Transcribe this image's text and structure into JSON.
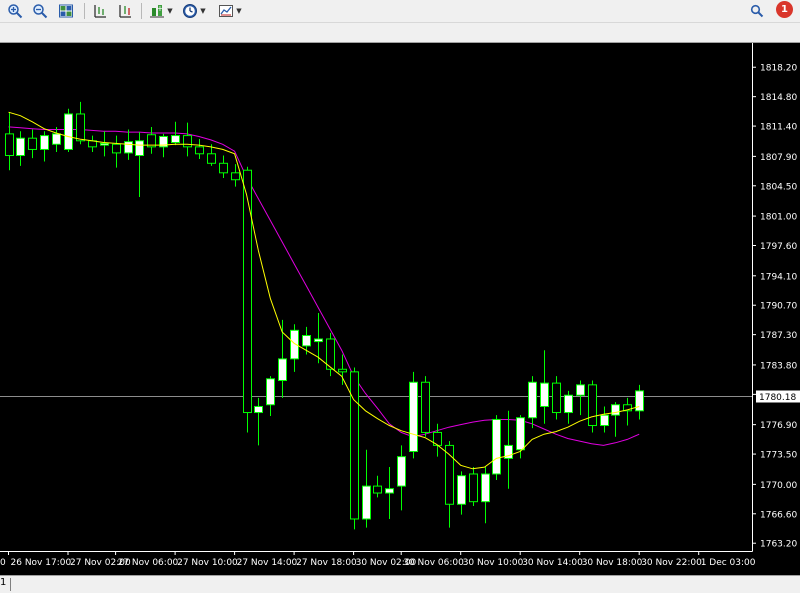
{
  "toolbar": {
    "items": [
      {
        "name": "zoom-in",
        "icon": "zoom-in-icon"
      },
      {
        "name": "zoom-out",
        "icon": "zoom-out-icon"
      },
      {
        "name": "tile-windows",
        "icon": "grid-icon"
      },
      {
        "name": "period-separators",
        "icon": "period-separator-icon"
      },
      {
        "name": "autoscroll",
        "icon": "autoscroll-icon"
      },
      {
        "name": "indicators",
        "icon": "indicator-add-icon"
      },
      {
        "name": "periodicity",
        "icon": "clock-icon"
      },
      {
        "name": "templates",
        "icon": "template-icon"
      }
    ],
    "search_icon": "search-icon",
    "notification_count": "1"
  },
  "bottombar": {
    "page_index": "1"
  },
  "colors": {
    "background": "#000000",
    "bull_candle": "#ffffff",
    "bear_candle": "#000000",
    "candle_outline": "#00ff00",
    "ma_fast": "#ffff00",
    "ma_slow": "#e000e0",
    "bid_line": "#8c8c8c",
    "axis_text": "#ffffff"
  },
  "chart_data": {
    "type": "candlestick",
    "current_price_label": "1780.18",
    "current_price": 1780.18,
    "ylim": [
      1762.3,
      1821.0
    ],
    "y_ticks": [
      "1818.20",
      "1814.80",
      "1811.40",
      "1807.90",
      "1804.50",
      "1801.00",
      "1797.60",
      "1794.10",
      "1790.70",
      "1787.30",
      "1783.80",
      "1780.40",
      "1776.90",
      "1773.50",
      "1770.00",
      "1766.60",
      "1763.20"
    ],
    "x_ticks": [
      {
        "label": "26 Nov 17:00",
        "index": 0
      },
      {
        "label": "27 Nov 02:00",
        "index": 5
      },
      {
        "label": "27 Nov 06:00",
        "index": 9
      },
      {
        "label": "27 Nov 10:00",
        "index": 14
      },
      {
        "label": "27 Nov 14:00",
        "index": 19
      },
      {
        "label": "27 Nov 18:00",
        "index": 24
      },
      {
        "label": "30 Nov 02:00",
        "index": 29
      },
      {
        "label": "30 Nov 06:00",
        "index": 33
      },
      {
        "label": "30 Nov 10:00",
        "index": 38
      },
      {
        "label": "30 Nov 14:00",
        "index": 43
      },
      {
        "label": "30 Nov 18:00",
        "index": 48
      },
      {
        "label": "30 Nov 22:00",
        "index": 53
      },
      {
        "label": "1 Dec 03:00",
        "index": 58
      }
    ],
    "x_tick_partial_left": "0",
    "candles": [
      {
        "o": 1810.5,
        "h": 1813.0,
        "l": 1806.3,
        "c": 1808.0
      },
      {
        "o": 1808.0,
        "h": 1810.8,
        "l": 1806.8,
        "c": 1810.0
      },
      {
        "o": 1810.0,
        "h": 1811.0,
        "l": 1807.7,
        "c": 1808.7
      },
      {
        "o": 1808.7,
        "h": 1810.8,
        "l": 1807.3,
        "c": 1810.3
      },
      {
        "o": 1809.3,
        "h": 1811.3,
        "l": 1808.4,
        "c": 1810.5
      },
      {
        "o": 1808.7,
        "h": 1813.4,
        "l": 1808.4,
        "c": 1812.8
      },
      {
        "o": 1812.8,
        "h": 1814.2,
        "l": 1809.3,
        "c": 1809.7
      },
      {
        "o": 1809.7,
        "h": 1810.3,
        "l": 1808.4,
        "c": 1809.0
      },
      {
        "o": 1809.2,
        "h": 1810.8,
        "l": 1807.9,
        "c": 1809.4
      },
      {
        "o": 1809.3,
        "h": 1810.3,
        "l": 1806.6,
        "c": 1808.3
      },
      {
        "o": 1808.3,
        "h": 1811.0,
        "l": 1807.5,
        "c": 1809.6
      },
      {
        "o": 1808.0,
        "h": 1810.7,
        "l": 1803.2,
        "c": 1809.7
      },
      {
        "o": 1810.4,
        "h": 1811.3,
        "l": 1808.2,
        "c": 1809.0
      },
      {
        "o": 1809.0,
        "h": 1810.5,
        "l": 1807.8,
        "c": 1810.2
      },
      {
        "o": 1809.5,
        "h": 1811.9,
        "l": 1809.2,
        "c": 1810.3
      },
      {
        "o": 1810.3,
        "h": 1811.8,
        "l": 1807.9,
        "c": 1809.0
      },
      {
        "o": 1809.0,
        "h": 1809.9,
        "l": 1807.6,
        "c": 1808.2
      },
      {
        "o": 1808.2,
        "h": 1809.3,
        "l": 1806.8,
        "c": 1807.1
      },
      {
        "o": 1807.1,
        "h": 1808.0,
        "l": 1805.4,
        "c": 1806.0
      },
      {
        "o": 1806.0,
        "h": 1807.0,
        "l": 1804.4,
        "c": 1805.2
      },
      {
        "o": 1806.3,
        "h": 1806.7,
        "l": 1776.0,
        "c": 1778.3
      },
      {
        "o": 1778.3,
        "h": 1780.0,
        "l": 1774.5,
        "c": 1779.0
      },
      {
        "o": 1779.2,
        "h": 1782.5,
        "l": 1777.9,
        "c": 1782.2
      },
      {
        "o": 1782.0,
        "h": 1789.0,
        "l": 1780.0,
        "c": 1784.5
      },
      {
        "o": 1784.5,
        "h": 1788.5,
        "l": 1783.0,
        "c": 1787.8
      },
      {
        "o": 1786.0,
        "h": 1788.2,
        "l": 1785.0,
        "c": 1787.2
      },
      {
        "o": 1786.5,
        "h": 1789.8,
        "l": 1784.0,
        "c": 1786.8
      },
      {
        "o": 1786.8,
        "h": 1787.5,
        "l": 1782.5,
        "c": 1783.3
      },
      {
        "o": 1783.3,
        "h": 1785.0,
        "l": 1781.5,
        "c": 1783.0
      },
      {
        "o": 1783.0,
        "h": 1783.5,
        "l": 1764.8,
        "c": 1766.0
      },
      {
        "o": 1766.0,
        "h": 1774.0,
        "l": 1765.0,
        "c": 1769.8
      },
      {
        "o": 1769.8,
        "h": 1771.0,
        "l": 1768.5,
        "c": 1769.0
      },
      {
        "o": 1769.0,
        "h": 1772.0,
        "l": 1766.0,
        "c": 1769.5
      },
      {
        "o": 1769.8,
        "h": 1774.5,
        "l": 1767.0,
        "c": 1773.2
      },
      {
        "o": 1773.8,
        "h": 1783.0,
        "l": 1773.0,
        "c": 1781.8
      },
      {
        "o": 1781.8,
        "h": 1782.5,
        "l": 1775.5,
        "c": 1776.0
      },
      {
        "o": 1776.0,
        "h": 1777.0,
        "l": 1773.2,
        "c": 1774.5
      },
      {
        "o": 1774.5,
        "h": 1775.0,
        "l": 1765.0,
        "c": 1767.7
      },
      {
        "o": 1767.7,
        "h": 1771.5,
        "l": 1766.5,
        "c": 1771.0
      },
      {
        "o": 1771.2,
        "h": 1772.0,
        "l": 1767.5,
        "c": 1768.0
      },
      {
        "o": 1768.0,
        "h": 1772.0,
        "l": 1765.5,
        "c": 1771.2
      },
      {
        "o": 1771.2,
        "h": 1778.0,
        "l": 1770.5,
        "c": 1777.5
      },
      {
        "o": 1773.0,
        "h": 1778.5,
        "l": 1769.5,
        "c": 1774.5
      },
      {
        "o": 1774.0,
        "h": 1778.0,
        "l": 1773.0,
        "c": 1777.7
      },
      {
        "o": 1777.7,
        "h": 1782.5,
        "l": 1776.5,
        "c": 1781.8
      },
      {
        "o": 1779.0,
        "h": 1785.5,
        "l": 1777.0,
        "c": 1781.7
      },
      {
        "o": 1781.7,
        "h": 1782.5,
        "l": 1777.5,
        "c": 1778.3
      },
      {
        "o": 1778.3,
        "h": 1780.8,
        "l": 1777.0,
        "c": 1780.3
      },
      {
        "o": 1780.3,
        "h": 1782.0,
        "l": 1778.0,
        "c": 1781.5
      },
      {
        "o": 1781.5,
        "h": 1782.0,
        "l": 1776.0,
        "c": 1776.8
      },
      {
        "o": 1776.8,
        "h": 1779.0,
        "l": 1776.0,
        "c": 1778.0
      },
      {
        "o": 1778.0,
        "h": 1779.5,
        "l": 1775.5,
        "c": 1779.2
      },
      {
        "o": 1779.2,
        "h": 1780.0,
        "l": 1776.8,
        "c": 1778.5
      },
      {
        "o": 1778.5,
        "h": 1781.5,
        "l": 1777.5,
        "c": 1780.8
      }
    ],
    "series": [
      {
        "kind": "ma_fast",
        "values": [
          1813,
          1812.6,
          1811.9,
          1811.1,
          1810.6,
          1810.2,
          1809.9,
          1809.7,
          1809.5,
          1809.4,
          1809.3,
          1809.2,
          1809.2,
          1809.2,
          1809.3,
          1809.3,
          1809.2,
          1809,
          1808.7,
          1808.2,
          1803.5,
          1797,
          1791.5,
          1787.6,
          1786.3,
          1785.5,
          1784.7,
          1783.6,
          1782.5,
          1779.8,
          1778.5,
          1777.6,
          1776.8,
          1776.2,
          1775.8,
          1775.4,
          1774.6,
          1773.5,
          1772.2,
          1771.8,
          1772,
          1773,
          1773.3,
          1773.8,
          1775.2,
          1775.8,
          1776.1,
          1776.6,
          1777.3,
          1777.8,
          1778.1,
          1778.3,
          1778.6,
          1779
        ]
      },
      {
        "kind": "ma_slow",
        "values": [
          1811.3,
          1811.2,
          1811.1,
          1811,
          1811,
          1811,
          1811,
          1810.9,
          1810.8,
          1810.8,
          1810.7,
          1810.7,
          1810.6,
          1810.6,
          1810.6,
          1810.5,
          1810.2,
          1809.8,
          1809.3,
          1808.5,
          1805.5,
          1803,
          1800.5,
          1798,
          1795.5,
          1793,
          1790.5,
          1788,
          1785.5,
          1782.5,
          1780.5,
          1778.8,
          1777,
          1776,
          1775.5,
          1775.8,
          1776.2,
          1776.6,
          1776.9,
          1777.2,
          1777.4,
          1777.5,
          1777.5,
          1777.4,
          1777,
          1776.4,
          1775.8,
          1775.3,
          1775,
          1774.7,
          1774.5,
          1774.8,
          1775.2,
          1775.8
        ]
      }
    ]
  }
}
